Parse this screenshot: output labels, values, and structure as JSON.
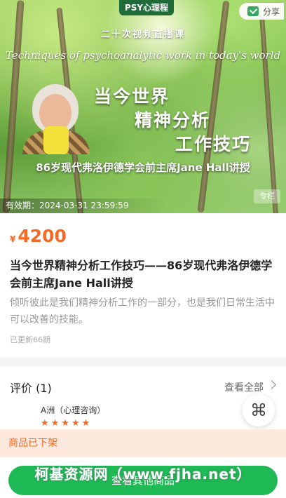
{
  "banner": {
    "brand": "PSY心理程",
    "share_label": "分享",
    "subtitle": "二十次视频直播课",
    "english_title": "Techniques of psychoanalytic work in today's world",
    "title_lines": [
      "当今世界",
      "精神分析",
      "工作技巧"
    ],
    "bottom_line": "86岁现代弗洛伊德学会前主席Jane  Hall讲授",
    "validity": "有效期：2024-03-31 23:59:59",
    "column_tag": "专栏"
  },
  "product": {
    "currency": "¥",
    "price": "4200",
    "title": "当今世界精神分析工作技巧——86岁现代弗洛伊德学会前主席Jane Hall讲授",
    "description": "倾听彼此是我们精神分析工作的一部分，也是我们日常生活中可以改善的技能。",
    "updated": "已更新66期"
  },
  "reviews": {
    "title": "评价 (1)",
    "view_all": "查看全部",
    "user": "A洲（心理咨询）",
    "stars": "★★★★★",
    "rating": 5
  },
  "status_bar": {
    "off_shelf": "商品已下架"
  },
  "bottom": {
    "button_label": "查看其他商品",
    "watermark": "柯基资源网（www.fjha.net）"
  },
  "colors": {
    "accent": "#f56a24",
    "green": "#1fb955",
    "brand_green": "#1f6b3a"
  },
  "icons": {
    "share": "wechat-share-icon",
    "float": "command-icon",
    "more": "chevron-right-icon"
  }
}
